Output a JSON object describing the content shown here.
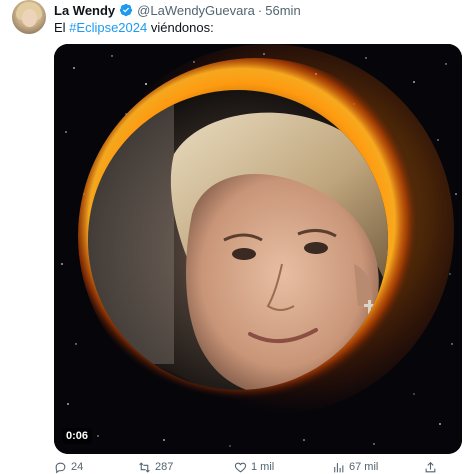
{
  "author": {
    "name": "La Wendy",
    "handle": "@LaWendyGuevara",
    "separator": "·",
    "time": "56min",
    "avatar_icon": "profile-photo"
  },
  "tweet": {
    "text_before": "El ",
    "hashtag": "#Eclipse2024",
    "text_after": " viéndonos:"
  },
  "media": {
    "type": "video",
    "duration": "0:06",
    "background_color": "#05050a",
    "corona_color": "#ff7a00"
  },
  "actions": {
    "replies": "24",
    "retweets": "287",
    "likes": "1 mil",
    "views": "67 mil"
  },
  "colors": {
    "link": "#1d9bf0",
    "muted": "#536471",
    "verified": "#1d9bf0"
  }
}
